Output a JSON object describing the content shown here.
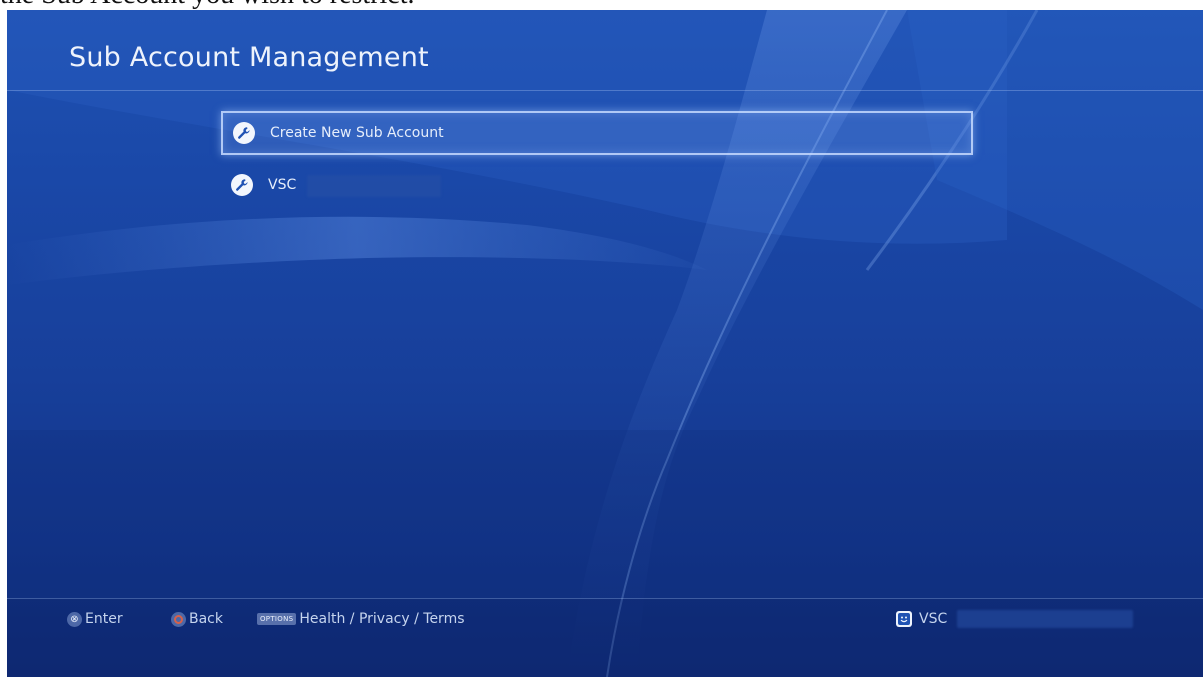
{
  "caption": "the Sub Account you wish to restrict.",
  "header": {
    "title": "Sub Account Management"
  },
  "menu": {
    "items": [
      {
        "label": "Create New Sub Account",
        "icon": "wrench-icon",
        "selected": true
      },
      {
        "label": "VSC",
        "icon": "wrench-icon",
        "selected": false
      }
    ]
  },
  "footer": {
    "enter": {
      "glyph": "⊗",
      "label": "Enter"
    },
    "back": {
      "label": "Back"
    },
    "options": {
      "glyph_text": "OPTIONS",
      "label": "Health / Privacy / Terms"
    },
    "user": {
      "icon": "user-face-icon",
      "name": "VSC"
    }
  },
  "colors": {
    "background": "#1a48a8",
    "text": "#eef3fc",
    "circle_button": "#d7604a"
  }
}
